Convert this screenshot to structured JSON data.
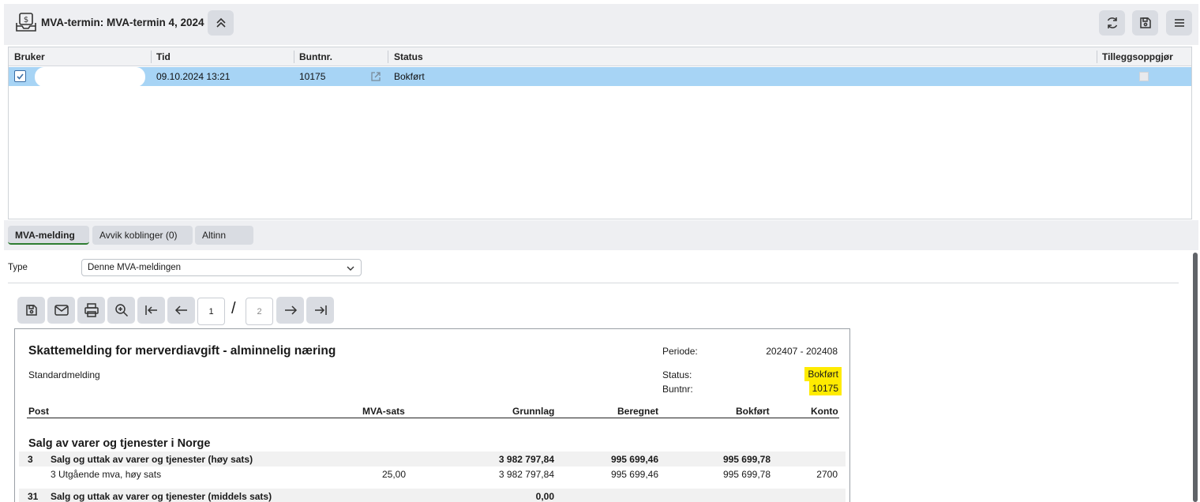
{
  "header": {
    "title": "MVA-termin: MVA-termin 4, 2024"
  },
  "grid": {
    "columns": [
      "Bruker",
      "Tid",
      "Buntnr.",
      "Status",
      "Tilleggsoppgjør"
    ],
    "rows": [
      {
        "bruker": "",
        "tid": "09.10.2024 13:21",
        "buntnr": "10175",
        "status": "Bokført",
        "tilleggsoppgjor": false,
        "selected": true
      }
    ]
  },
  "tabs": [
    {
      "label": "MVA-melding",
      "active": true
    },
    {
      "label": "Avvik koblinger (0)",
      "active": false
    },
    {
      "label": "Altinn",
      "active": false
    }
  ],
  "type_filter": {
    "label": "Type",
    "value": "Denne MVA-meldingen"
  },
  "report_toolbar": {
    "current_page": "1",
    "total_pages": "2",
    "separator": "/"
  },
  "report": {
    "title": "Skattemelding for merverdiavgift - alminnelig næring",
    "subtitle": "Standardmelding",
    "periode_label": "Periode:",
    "periode_value": "202407 - 202408",
    "status_label": "Status:",
    "status_value": "Bokført",
    "buntnr_label": "Buntnr:",
    "buntnr_value": "10175",
    "columns": {
      "post": "Post",
      "sats": "MVA-sats",
      "grunnlag": "Grunnlag",
      "beregnet": "Beregnet",
      "bokfort": "Bokført",
      "konto": "Konto"
    },
    "section": "Salg av varer og tjenester i Norge",
    "rows": [
      {
        "nr": "3",
        "text": "Salg og uttak av varer og tjenester (høy sats)",
        "sats": "",
        "grunnlag": "3 982 797,84",
        "beregnet": "995 699,46",
        "bokfort": "995 699,78",
        "konto": "",
        "bold": true
      },
      {
        "nr": "",
        "text": "3 Utgående mva, høy sats",
        "sats": "25,00",
        "grunnlag": "3 982 797,84",
        "beregnet": "995 699,46",
        "bokfort": "995 699,78",
        "konto": "2700",
        "bold": false
      },
      {
        "nr": "31",
        "text": "Salg og uttak av varer og tjenester (middels sats)",
        "sats": "",
        "grunnlag": "0,00",
        "beregnet": "",
        "bokfort": "",
        "konto": "",
        "bold": true
      }
    ]
  },
  "colors": {
    "selected_row": "#a7d4f5",
    "highlight": "#ffeb00",
    "active_tab_underline": "#2e7d32"
  }
}
